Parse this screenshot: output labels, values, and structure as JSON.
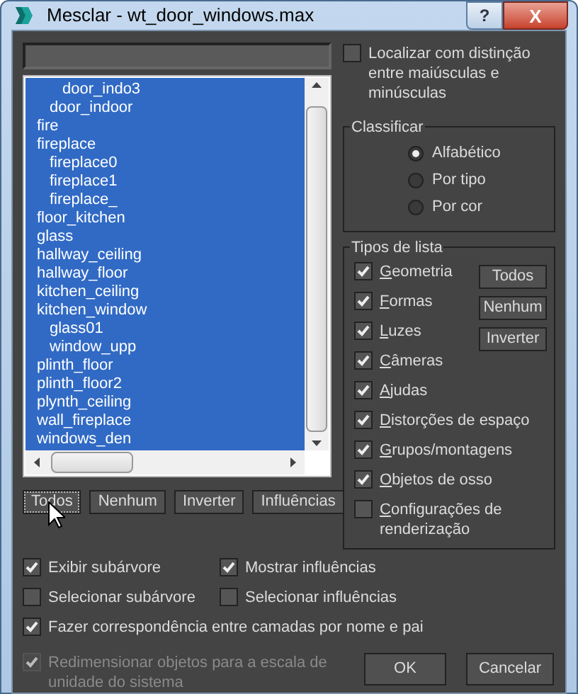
{
  "window": {
    "title": "Mesclar - wt_door_windows.max",
    "buttons": [
      "?",
      "X"
    ]
  },
  "case_sensitive": {
    "label": "Localizar com distinção entre maiúsculas e minúsculas",
    "checked": false
  },
  "objects": [
    {
      "children": [
        {
          "children": [
            {
              "label": "door_indo3",
              "selected": true
            }
          ]
        },
        {
          "label": "door_indoor",
          "selected": true
        }
      ]
    },
    {
      "label": "fire",
      "selected": true
    },
    {
      "label": "fireplace",
      "selected": true,
      "children": [
        {
          "label": "fireplace0",
          "selected": true
        },
        {
          "label": "fireplace1",
          "selected": true
        },
        {
          "label": "fireplace_",
          "selected": true
        }
      ]
    },
    {
      "label": "floor_kitchen",
      "selected": true
    },
    {
      "label": "glass",
      "selected": true
    },
    {
      "label": "hallway_ceiling",
      "selected": true
    },
    {
      "label": "hallway_floor",
      "selected": true
    },
    {
      "label": "kitchen_ceiling",
      "selected": true
    },
    {
      "label": "kitchen_window",
      "selected": true,
      "children": [
        {
          "label": "glass01",
          "selected": true
        },
        {
          "label": "window_upp",
          "selected": true
        }
      ]
    },
    {
      "label": "plinth_floor",
      "selected": true
    },
    {
      "label": "plinth_floor2",
      "selected": true
    },
    {
      "label": "plynth_ceiling",
      "selected": true
    },
    {
      "label": "wall_fireplace",
      "selected": true
    },
    {
      "label": "windows_den",
      "selected": true
    }
  ],
  "list_buttons": [
    "Todos",
    "Nenhum",
    "Inverter",
    "Influências"
  ],
  "sort": {
    "title": "Classificar",
    "options": [
      {
        "label": "Alfabético",
        "selected": true
      },
      {
        "label": "Por tipo",
        "selected": false
      },
      {
        "label": "Por cor",
        "selected": false
      }
    ]
  },
  "list_types": {
    "title": "Tipos de lista",
    "items": [
      {
        "label": "Geometria",
        "checked": true
      },
      {
        "label": "Formas",
        "checked": true
      },
      {
        "label": "Luzes",
        "checked": true
      },
      {
        "label": "Câmeras",
        "checked": true
      },
      {
        "label": "Ajudas",
        "checked": true
      },
      {
        "label": "Distorções de espaço",
        "checked": true
      },
      {
        "label": "Grupos/montagens",
        "checked": true
      },
      {
        "label": "Objetos de osso",
        "checked": true
      },
      {
        "label": "Configurações de renderização",
        "checked": false
      }
    ],
    "buttons": [
      "Todos",
      "Nenhum",
      "Inverter"
    ]
  },
  "options": [
    {
      "label": "Exibir subárvore",
      "checked": true,
      "disabled": false
    },
    {
      "label": "Mostrar influências",
      "checked": true,
      "disabled": false
    },
    {
      "label": "Selecionar subárvore",
      "checked": false,
      "disabled": false
    },
    {
      "label": "Selecionar influências",
      "checked": false,
      "disabled": false
    },
    {
      "label": "Fazer correspondência entre camadas por nome e pai",
      "checked": true,
      "disabled": false
    },
    {
      "label": "Redimensionar objetos para a escala de unidade do sistema",
      "checked": true,
      "disabled": true
    }
  ],
  "footer_buttons": [
    "OK",
    "Cancelar"
  ]
}
